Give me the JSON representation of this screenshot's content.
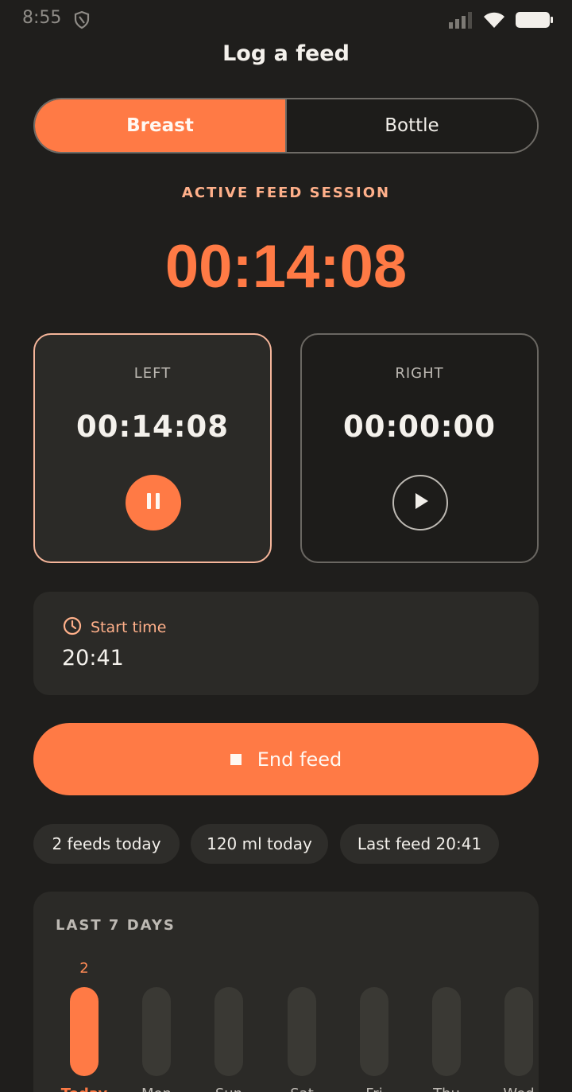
{
  "status_bar": {
    "time": "8:55"
  },
  "header": {
    "title": "Log a feed"
  },
  "mode_toggle": {
    "breast_label": "Breast",
    "bottle_label": "Bottle",
    "selected": "Breast"
  },
  "session": {
    "label": "ACTIVE FEED SESSION",
    "total_time": "00:14:08"
  },
  "sides": {
    "left": {
      "label": "LEFT",
      "time": "00:14:08",
      "state": "running"
    },
    "right": {
      "label": "RIGHT",
      "time": "00:00:00",
      "state": "paused"
    }
  },
  "start_time": {
    "label": "Start time",
    "value": "20:41"
  },
  "end_button": {
    "label": "End feed"
  },
  "chips": [
    "2 feeds today",
    "120 ml today",
    "Last feed 20:41"
  ],
  "history": {
    "title": "LAST 7 DAYS",
    "days": [
      {
        "label": "Today",
        "count": "2",
        "active": true
      },
      {
        "label": "Mon",
        "count": "",
        "active": false
      },
      {
        "label": "Sun",
        "count": "",
        "active": false
      },
      {
        "label": "Sat",
        "count": "",
        "active": false
      },
      {
        "label": "Fri",
        "count": "",
        "active": false
      },
      {
        "label": "Thu",
        "count": "",
        "active": false
      },
      {
        "label": "Wed",
        "count": "",
        "active": false
      }
    ]
  },
  "colors": {
    "accent": "#ff7a45",
    "accent_soft": "#ffb08a",
    "background": "#1f1e1c",
    "card": "#2b2a27"
  }
}
